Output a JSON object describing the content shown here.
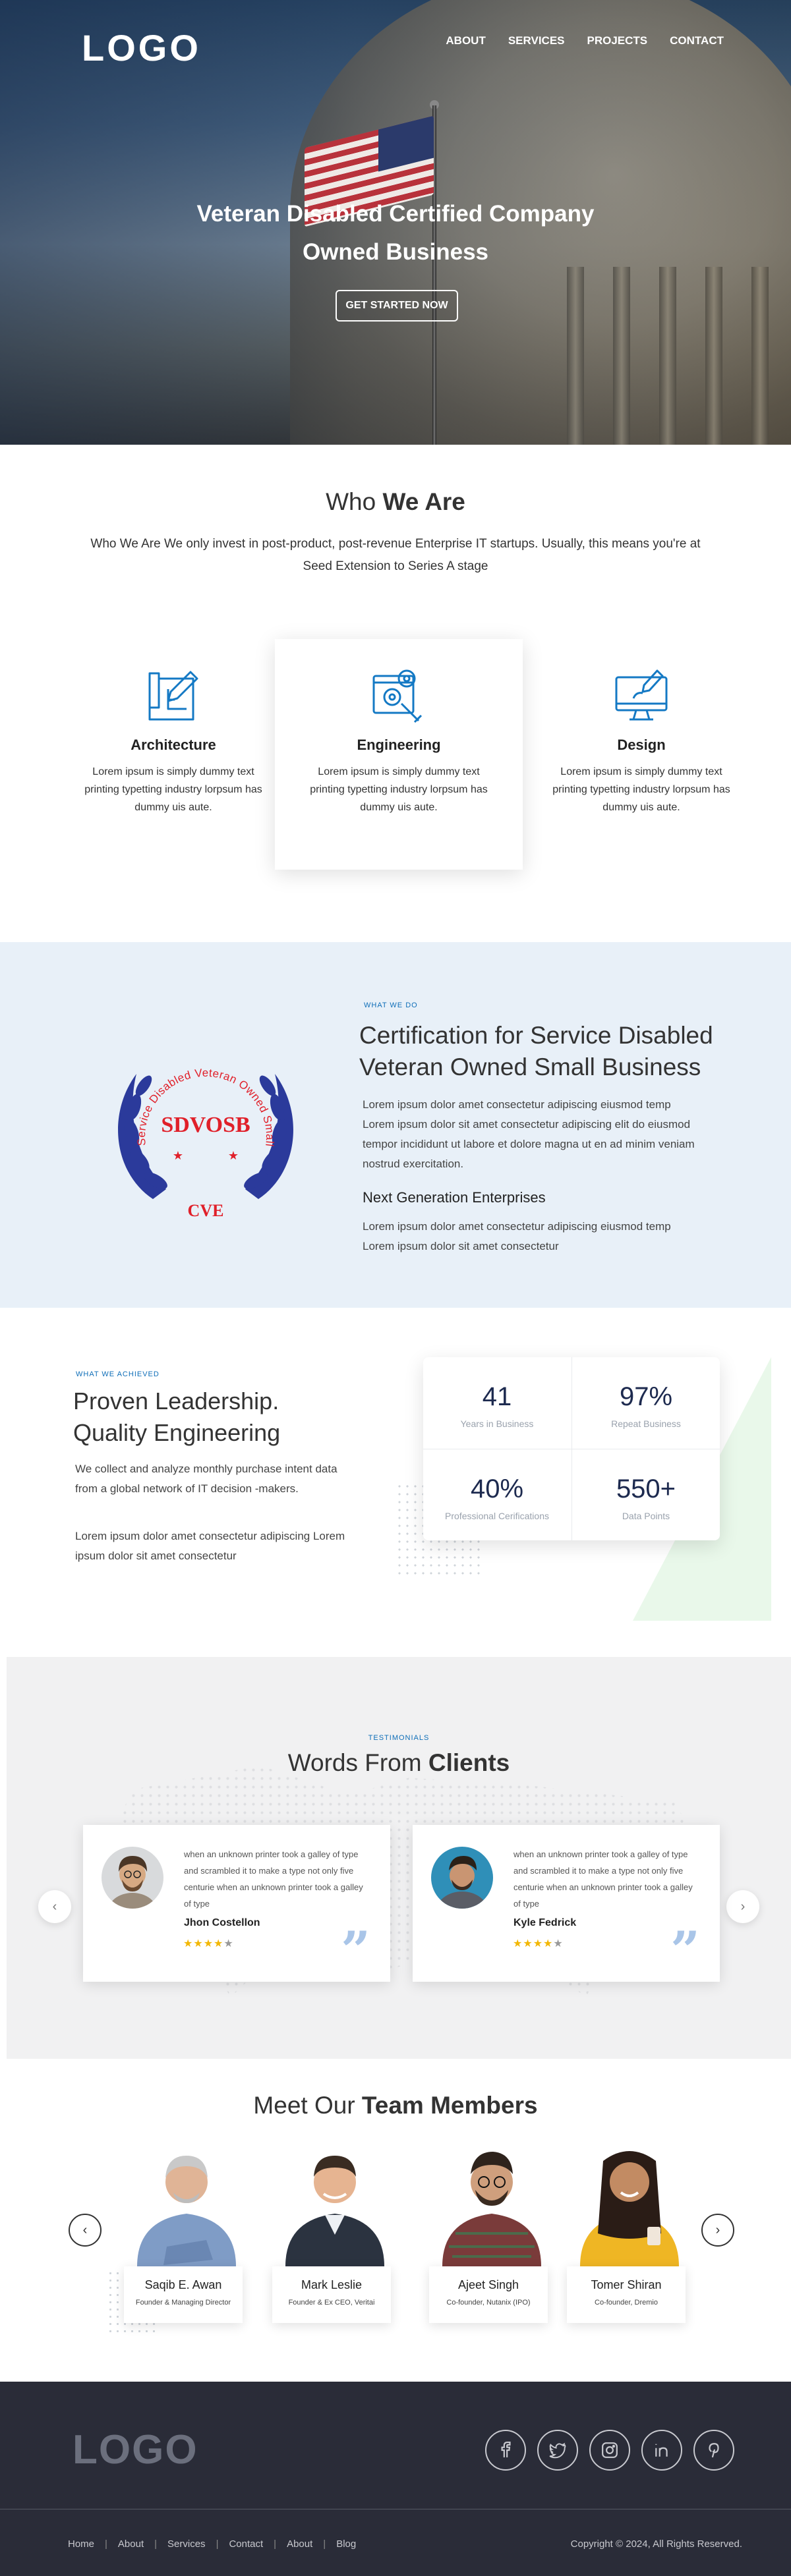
{
  "header": {
    "logo": "LOGO",
    "nav": [
      "ABOUT",
      "SERVICES",
      "PROJECTS",
      "CONTACT"
    ]
  },
  "hero": {
    "title_line1": "Veteran Disabled Certified Company",
    "title_line2": "Owned Business",
    "cta": "GET STARTED NOW"
  },
  "who": {
    "title_plain": "Who ",
    "title_bold": "We Are",
    "lead": "Who We Are We only invest in post-product, post-revenue Enterprise IT startups. Usually, this means you're at Seed Extension to Series A stage",
    "cards": [
      {
        "title": "Architecture",
        "text": "Lorem ipsum is simply dummy text printing typetting industry lorpsum has dummy uis aute.",
        "icon": "blueprint-icon"
      },
      {
        "title": "Engineering",
        "text": "Lorem ipsum is simply dummy text printing typetting industry lorpsum has dummy uis aute.",
        "icon": "gears-wrench-icon"
      },
      {
        "title": "Design",
        "text": "Lorem ipsum is simply dummy text printing typetting industry lorpsum has dummy uis aute.",
        "icon": "monitor-brush-icon"
      }
    ]
  },
  "cert": {
    "eyebrow": "WHAT WE DO",
    "title": "Certification for Service Disabled Veteran Owned Small Business",
    "p1": "Lorem ipsum dolor amet consectetur adipiscing eiusmod temp Lorem ipsum dolor sit amet consectetur adipiscing elit do eiusmod tempor incididunt ut labore et dolore magna ut en ad minim veniam nostrud exercitation.",
    "subtitle": "Next Generation Enterprises",
    "p2": "Lorem ipsum dolor amet consectetur adipiscing eiusmod temp Lorem ipsum dolor sit amet consectetur",
    "seal": {
      "arc_text": "Service Disabled Veteran Owned Small Business",
      "center": "SDVOSB",
      "badge": "CVE"
    }
  },
  "leadership": {
    "eyebrow": "WHAT WE ACHIEVED",
    "title": "Proven Leadership. Quality Engineering",
    "p1": "We collect and analyze monthly purchase intent data from a global network of IT decision -makers.",
    "p2": "Lorem ipsum dolor amet consectetur adipiscing Lorem ipsum dolor sit amet consectetur",
    "stats": [
      {
        "num": "41",
        "label": "Years in Business"
      },
      {
        "num": "97%",
        "label": "Repeat Business"
      },
      {
        "num": "40%",
        "label": "Professional Cerifications"
      },
      {
        "num": "550+",
        "label": "Data Points"
      }
    ]
  },
  "testimonials": {
    "eyebrow": "TESTIMONIALS",
    "title_plain": "Words From ",
    "title_bold": "Clients",
    "items": [
      {
        "text": "when an unknown printer took a galley of type and scrambled it to make a type not only five centurie when an unknown printer took a galley of type",
        "name": "Jhon Costellon",
        "rating": 4
      },
      {
        "text": "when an unknown printer took a galley of type and scrambled it to make a type not only five centurie when an unknown printer took a galley of type",
        "name": "Kyle Fedrick",
        "rating": 4
      }
    ],
    "prev": "‹",
    "next": "›"
  },
  "team": {
    "title_plain": "Meet Our ",
    "title_bold": "Team Members",
    "members": [
      {
        "name": "Saqib E. Awan",
        "role": "Founder & Managing Director"
      },
      {
        "name": "Mark Leslie",
        "role": "Founder & Ex CEO, Veritai"
      },
      {
        "name": "Ajeet Singh",
        "role": "Co-founder, Nutanix (IPO)"
      },
      {
        "name": "Tomer Shiran",
        "role": "Co-founder, Dremio"
      }
    ],
    "prev": "‹",
    "next": "›"
  },
  "footer": {
    "logo": "LOGO",
    "socials": [
      "facebook-icon",
      "twitter-icon",
      "instagram-icon",
      "linkedin-icon",
      "pinterest-icon"
    ],
    "links": [
      "Home",
      "About",
      "Services",
      "Contact",
      "About",
      "Blog"
    ],
    "copyright": "Copyright © 2024, All Rights Reserved."
  },
  "colors": {
    "accent_blue": "#0e6eb8",
    "light_bg": "#e8f0f8",
    "footer_bg": "#2a2c38",
    "seal_blue": "#2b3a9b",
    "seal_red": "#e0202a",
    "star": "#f2b705"
  }
}
